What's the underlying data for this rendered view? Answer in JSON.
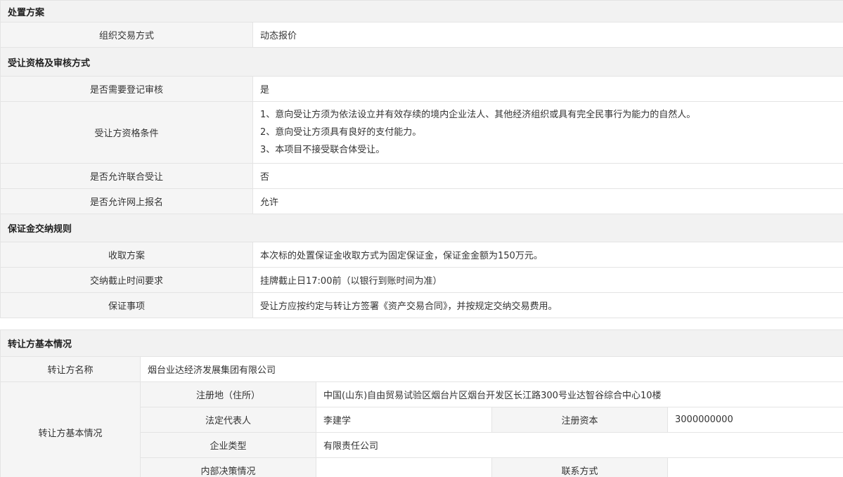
{
  "section1": {
    "title": "处置方案",
    "rows": [
      {
        "label": "组织交易方式",
        "value": "动态报价"
      }
    ]
  },
  "section2": {
    "title": "受让资格及审核方式",
    "need_review": {
      "label": "是否需要登记审核",
      "value": "是"
    },
    "qualification": {
      "label": "受让方资格条件",
      "lines": [
        "1、意向受让方须为依法设立并有效存续的境内企业法人、其他经济组织或具有完全民事行为能力的自然人。",
        "2、意向受让方须具有良好的支付能力。",
        "3、本项目不接受联合体受让。"
      ]
    },
    "allow_joint": {
      "label": "是否允许联合受让",
      "value": "否"
    },
    "allow_online": {
      "label": "是否允许网上报名",
      "value": "允许"
    }
  },
  "section3": {
    "title": "保证金交纳规则",
    "collect_plan": {
      "label": "收取方案",
      "value": "本次标的处置保证金收取方式为固定保证金，保证金金额为150万元。"
    },
    "deadline": {
      "label": "交纳截止时间要求",
      "value": "挂牌截止日17:00前（以银行到账时间为准）"
    },
    "matters": {
      "label": "保证事项",
      "value": "受让方应按约定与转让方签署《资产交易合同》，并按规定交纳交易费用。"
    }
  },
  "section4": {
    "title": "转让方基本情况",
    "name": {
      "label": "转让方名称",
      "value": "烟台业达经济发展集团有限公司"
    },
    "group_label": "转让方基本情况",
    "address": {
      "label": "注册地（住所）",
      "value": "中国(山东)自由贸易试验区烟台片区烟台开发区长江路300号业达智谷综合中心10楼"
    },
    "legal_rep": {
      "label": "法定代表人",
      "value": "李建学"
    },
    "capital": {
      "label": "注册资本",
      "value": "3000000000"
    },
    "company_type": {
      "label": "企业类型",
      "value": "有限责任公司"
    },
    "decision": {
      "label": "内部决策情况",
      "value": ""
    },
    "contact": {
      "label": "联系方式",
      "value": ""
    }
  }
}
